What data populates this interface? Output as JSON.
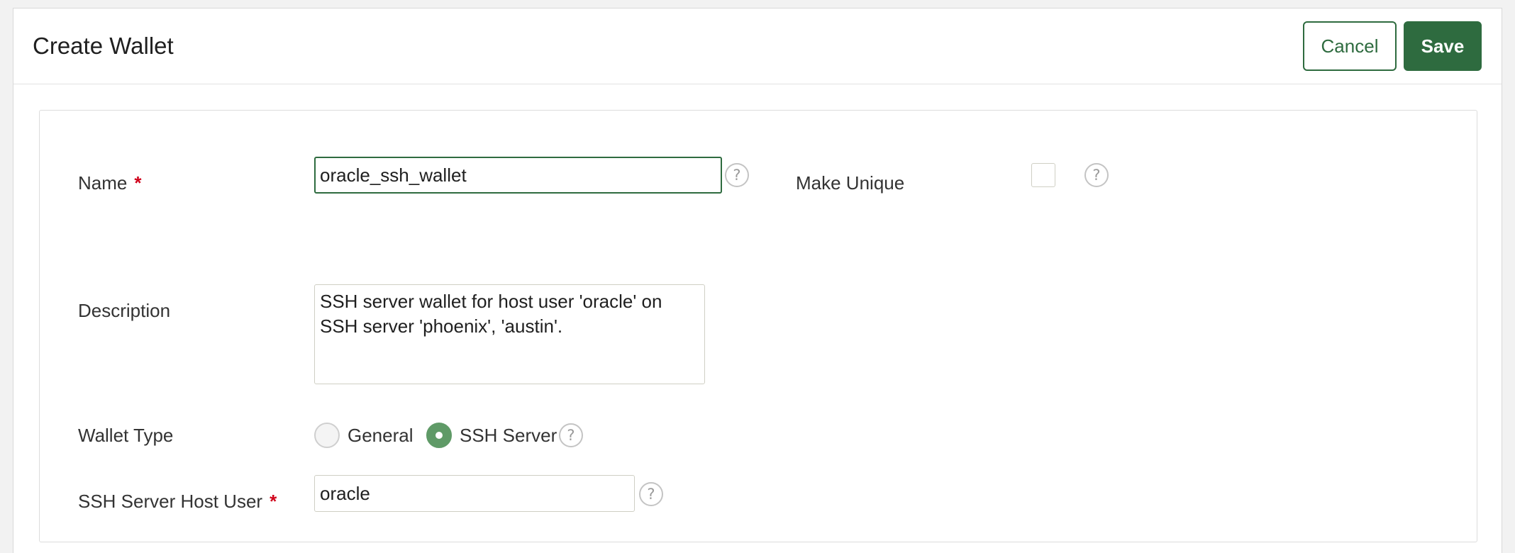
{
  "dialog": {
    "title": "Create Wallet",
    "cancel_label": "Cancel",
    "save_label": "Save"
  },
  "form": {
    "name": {
      "label": "Name",
      "required_mark": "*",
      "value": "oracle_ssh_wallet",
      "help_glyph": "?"
    },
    "make_unique": {
      "label": "Make Unique",
      "checked": false,
      "help_glyph": "?"
    },
    "description": {
      "label": "Description",
      "value": "SSH server wallet for host user 'oracle' on SSH server 'phoenix', 'austin'."
    },
    "wallet_type": {
      "label": "Wallet Type",
      "options": [
        {
          "label": "General",
          "selected": false
        },
        {
          "label": "SSH Server",
          "selected": true
        }
      ],
      "help_glyph": "?"
    },
    "ssh_host_user": {
      "label": "SSH Server Host User",
      "required_mark": "*",
      "value": "oracle",
      "help_glyph": "?"
    }
  },
  "colors": {
    "accent": "#2e6b3f",
    "radio_selected": "#5f9a67",
    "required": "#d0021b"
  },
  "icons": {
    "help": "help-icon"
  }
}
